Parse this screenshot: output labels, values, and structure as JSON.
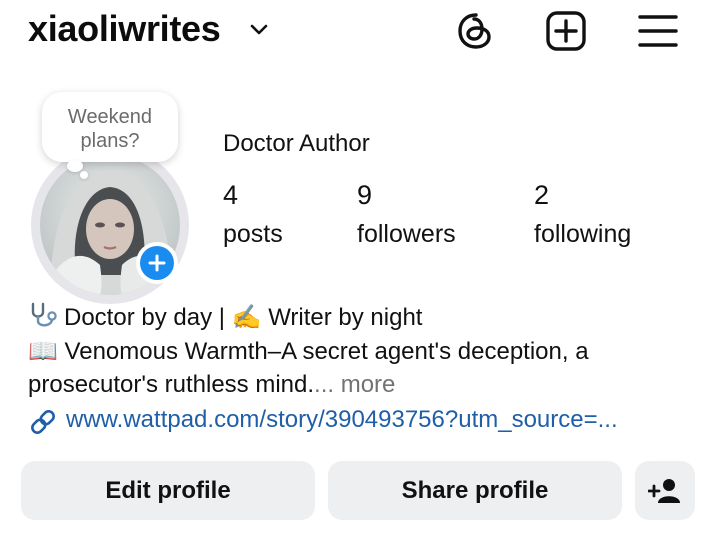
{
  "header": {
    "username": "xiaoliwrites",
    "icons": [
      "chevron-down-icon",
      "threads-icon",
      "create-post-icon",
      "menu-icon"
    ]
  },
  "note": {
    "line1": "Weekend",
    "line2": "plans?"
  },
  "profile": {
    "display_name": "Doctor Author",
    "stats": {
      "posts": {
        "value": "4",
        "label": "posts"
      },
      "followers": {
        "value": "9",
        "label": "followers"
      },
      "following": {
        "value": "2",
        "label": "following"
      }
    }
  },
  "bio": {
    "line1": "Doctor by day | ✍️ Writer by night",
    "line2": "📖 Venomous Warmth–A secret agent's deception, a",
    "line3": "prosecutor's ruthless mind.",
    "more": "... more",
    "link": "www.wattpad.com/story/390493756?utm_source=..."
  },
  "buttons": {
    "edit_profile": "Edit profile",
    "share_profile": "Share profile"
  },
  "colors": {
    "accent": "#1a8cf0",
    "link": "#1f5fa8",
    "button_bg": "#eeeff1"
  }
}
